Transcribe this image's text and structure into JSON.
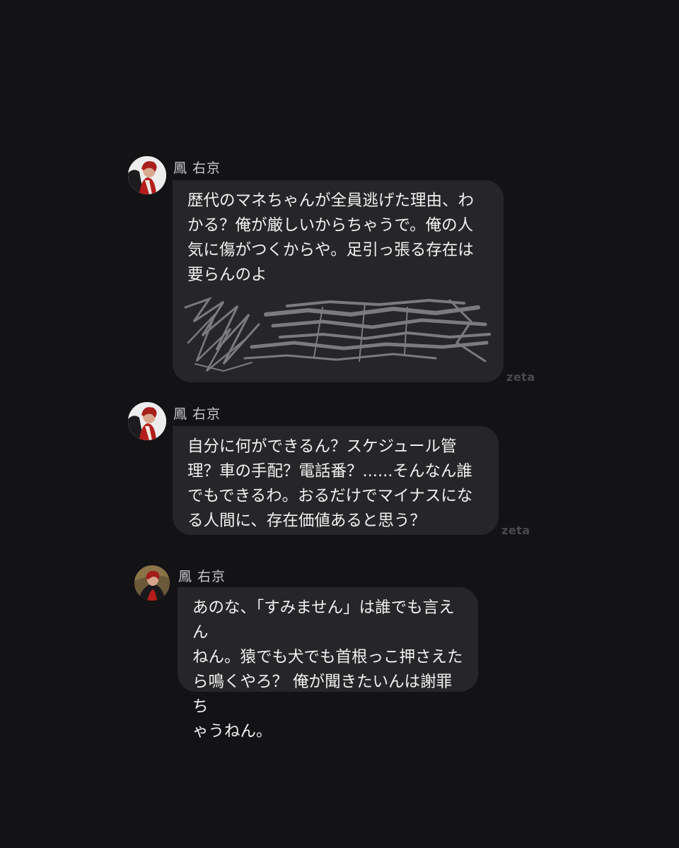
{
  "colors": {
    "background": "#131315",
    "bubble": "#262628",
    "sender_text": "#c8c8cb",
    "message_text": "#f1f1f2",
    "watermark": "#4a4a4d",
    "avatar_accent": "#c0201e"
  },
  "messages": [
    {
      "sender": "鳳 右京",
      "avatar_icon": "character-avatar",
      "lines": [
        "歴代のマネちゃんが全員逃げた理由、わ",
        "かる？俺が厳しいからちゃうで。俺の人",
        "気に傷がつくからや。足引っ張る存在は",
        "要らんのよ"
      ],
      "redacted_icon": "scribble-redaction",
      "watermark": "zeta"
    },
    {
      "sender": "鳳 右京",
      "avatar_icon": "character-avatar",
      "lines": [
        "自分に何ができるん？スケジュール管",
        "理？車の手配？電話番？......そんなん誰",
        "でもできるわ。おるだけでマイナスにな",
        "る人間に、存在価値あると思う？"
      ],
      "watermark": "zeta"
    },
    {
      "sender": "鳳 右京",
      "avatar_icon": "character-avatar",
      "lines": [
        "あのな、「すみません」は誰でも言えん",
        "ねん。猿でも犬でも首根っこ押さえた",
        "ら鳴くやろ？ 俺が聞きたいんは謝罪ち",
        "ゃうねん。"
      ]
    }
  ]
}
